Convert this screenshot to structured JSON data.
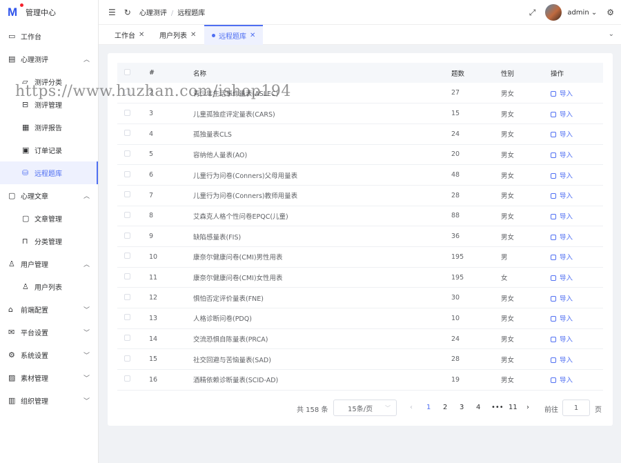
{
  "app": {
    "title": "管理中心",
    "logo": "M"
  },
  "sidebar": {
    "items": [
      {
        "label": "工作台",
        "icon": "monitor-icon",
        "level": 1
      },
      {
        "label": "心理测评",
        "icon": "clipboard-icon",
        "level": 1,
        "expanded": true
      },
      {
        "label": "测评分类",
        "icon": "folder-icon",
        "level": 2
      },
      {
        "label": "测评管理",
        "icon": "archive-icon",
        "level": 2
      },
      {
        "label": "测评报告",
        "icon": "report-icon",
        "level": 2
      },
      {
        "label": "订单记录",
        "icon": "order-icon",
        "level": 2
      },
      {
        "label": "远程题库",
        "icon": "database-icon",
        "level": 2,
        "active": true
      },
      {
        "label": "心理文章",
        "icon": "message-icon",
        "level": 1,
        "expanded": true
      },
      {
        "label": "文章管理",
        "icon": "chat-icon",
        "level": 2
      },
      {
        "label": "分类管理",
        "icon": "bookmark-icon",
        "level": 2
      },
      {
        "label": "用户管理",
        "icon": "user-icon",
        "level": 1,
        "expanded": true
      },
      {
        "label": "用户列表",
        "icon": "user-list-icon",
        "level": 2
      },
      {
        "label": "前端配置",
        "icon": "shop-icon",
        "level": 1,
        "expanded": false
      },
      {
        "label": "平台设置",
        "icon": "mail-icon",
        "level": 1,
        "expanded": false
      },
      {
        "label": "系统设置",
        "icon": "settings-icon",
        "level": 1,
        "expanded": false
      },
      {
        "label": "素材管理",
        "icon": "image-icon",
        "level": 1,
        "expanded": false
      },
      {
        "label": "组织管理",
        "icon": "building-icon",
        "level": 1,
        "expanded": false
      }
    ]
  },
  "header": {
    "breadcrumb": [
      "心理测评",
      "远程题库"
    ],
    "username": "admin"
  },
  "tabs": [
    {
      "label": "工作台",
      "active": false
    },
    {
      "label": "用户列表",
      "active": false
    },
    {
      "label": "远程题库",
      "active": true
    }
  ],
  "table": {
    "headers": [
      "#",
      "名称",
      "题数",
      "性别",
      "操作"
    ],
    "action_label": "导入",
    "rows": [
      [
        "2",
        "青少年生活事件量表(ASLEC)",
        "27",
        "男女"
      ],
      [
        "3",
        "儿童孤独症评定量表(CARS)",
        "15",
        "男女"
      ],
      [
        "4",
        "孤独量表CLS",
        "24",
        "男女"
      ],
      [
        "5",
        "容纳他人量表(AO)",
        "20",
        "男女"
      ],
      [
        "6",
        "儿童行为问卷(Conners)父母用量表",
        "48",
        "男女"
      ],
      [
        "7",
        "儿童行为问卷(Conners)教师用量表",
        "28",
        "男女"
      ],
      [
        "8",
        "艾森克人格个性问卷EPQC(儿童)",
        "88",
        "男女"
      ],
      [
        "9",
        "缺陷感量表(FIS)",
        "36",
        "男女"
      ],
      [
        "10",
        "康奈尔健康问卷(CMI)男性用表",
        "195",
        "男"
      ],
      [
        "11",
        "康奈尔健康问卷(CMI)女性用表",
        "195",
        "女"
      ],
      [
        "12",
        "惧怕否定评价量表(FNE)",
        "30",
        "男女"
      ],
      [
        "13",
        "人格诊断问卷(PDQ)",
        "10",
        "男女"
      ],
      [
        "14",
        "交流恐惧自陈量表(PRCA)",
        "24",
        "男女"
      ],
      [
        "15",
        "社交回避与苦恼量表(SAD)",
        "28",
        "男女"
      ],
      [
        "16",
        "酒精依赖诊断量表(SCID-AD)",
        "19",
        "男女"
      ]
    ]
  },
  "pagination": {
    "total": "共 158 条",
    "page_size": "15条/页",
    "pages": [
      "1",
      "2",
      "3",
      "4",
      "•••",
      "11"
    ],
    "current": "1",
    "goto_label": "前往",
    "goto_value": "1",
    "page_word": "页"
  },
  "watermark": "https://www.huzhan.com/ishop194",
  "colors": {
    "accent": "#4e6ef2",
    "logo_red": "#f5222d"
  }
}
